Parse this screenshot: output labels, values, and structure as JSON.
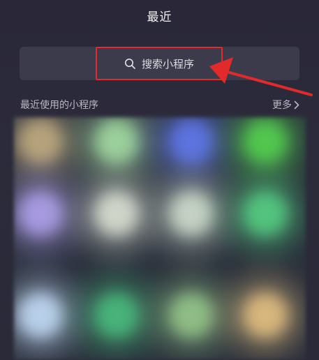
{
  "header": {
    "title": "最近"
  },
  "search": {
    "placeholder": "搜索小程序"
  },
  "recent": {
    "section_label": "最近使用的小程序",
    "more_label": "更多"
  },
  "colors": {
    "background": "#2b2a3b",
    "search_bar": "#3b3b4b",
    "highlight": "#e22a2a",
    "app_colors": [
      "#b6a37c",
      "#9bcf9b",
      "#5d73df",
      "#52c64f",
      "#a79ae0",
      "#cfd5c9",
      "#c4d1c4",
      "#53c47f",
      "#b9d0ea",
      "#48b37a",
      "#8fbd86",
      "#d8b77d"
    ]
  },
  "icons": [
    "search-icon",
    "chevron-right-icon"
  ]
}
